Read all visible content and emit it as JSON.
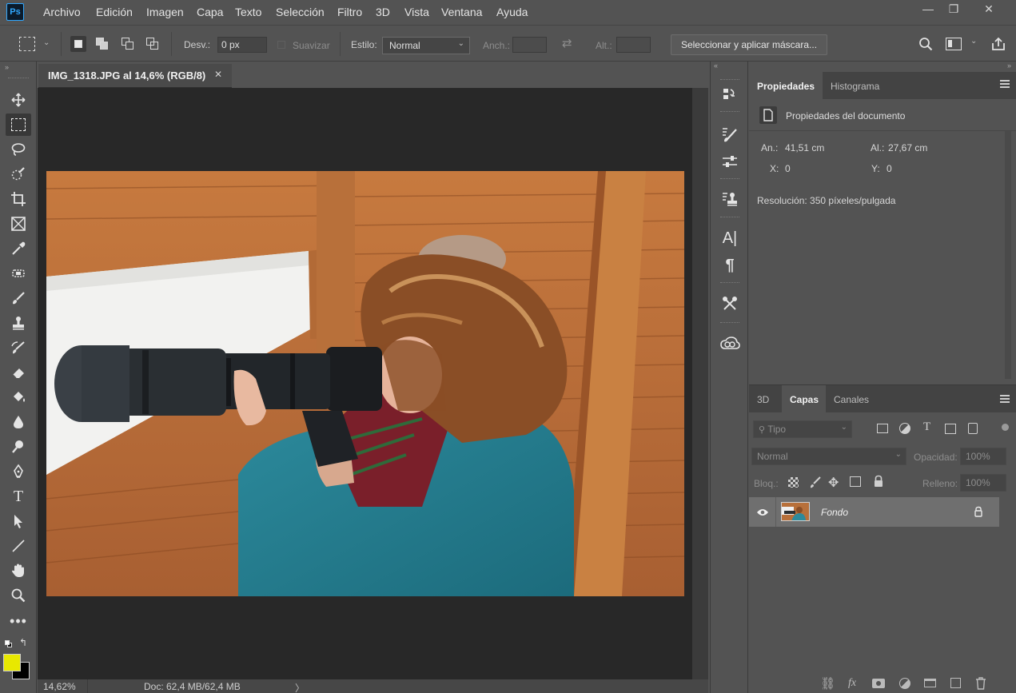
{
  "app": {
    "logo": "Ps"
  },
  "menu": [
    "Archivo",
    "Edición",
    "Imagen",
    "Capa",
    "Texto",
    "Selección",
    "Filtro",
    "3D",
    "Vista",
    "Ventana",
    "Ayuda"
  ],
  "window_controls": {
    "minimize": "—",
    "restore": "❐",
    "close": "✕"
  },
  "options": {
    "desv_label": "Desv.:",
    "desv_value": "0 px",
    "suavizar_label": "Suavizar",
    "estilo_label": "Estilo:",
    "estilo_value": "Normal",
    "anch_label": "Anch.:",
    "alt_label": "Alt.:",
    "mask_button": "Seleccionar y aplicar máscara..."
  },
  "document": {
    "tab_title": "IMG_1318.JPG al 14,6% (RGB/8)",
    "zoom": "14,62%",
    "doc_info": "Doc: 62,4 MB/62,4 MB",
    "status_arrow": "〉"
  },
  "properties": {
    "tabs": [
      "Propiedades",
      "Histograma"
    ],
    "section_title": "Propiedades del documento",
    "an_label": "An.:",
    "an_value": "41,51 cm",
    "al_label": "Al.:",
    "al_value": "27,67 cm",
    "x_label": "X:",
    "x_value": "0",
    "y_label": "Y:",
    "y_value": "0",
    "resolution": "Resolución: 350 píxeles/pulgada"
  },
  "layers": {
    "tabs": [
      "3D",
      "Capas",
      "Canales"
    ],
    "filter_placeholder": "Tipo",
    "blend_mode": "Normal",
    "opacity_label": "Opacidad:",
    "opacity_value": "100%",
    "lock_label": "Bloq.:",
    "fill_label": "Relleno:",
    "fill_value": "100%",
    "items": [
      {
        "name": "Fondo"
      }
    ]
  },
  "colors": {
    "foreground": "#e8e800",
    "background": "#000000",
    "accent": "#31a8ff"
  }
}
